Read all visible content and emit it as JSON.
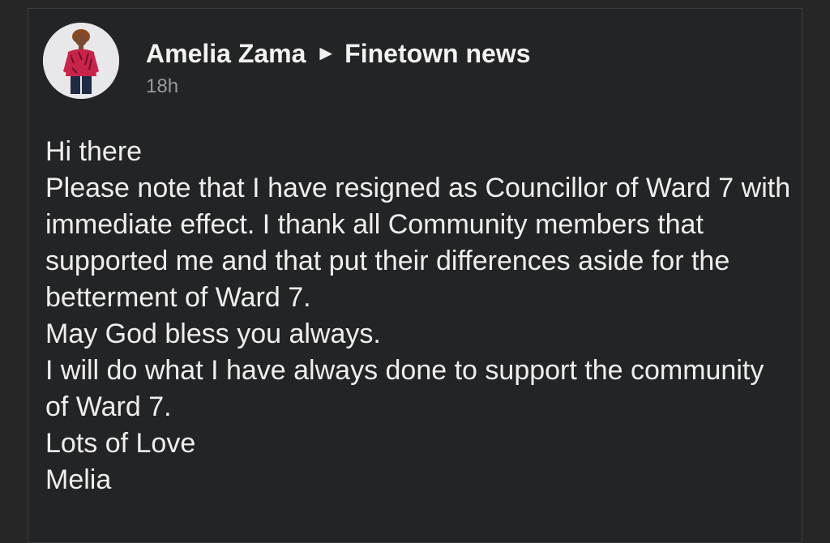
{
  "post": {
    "author": "Amelia Zama",
    "arrow": "►",
    "group": "Finetown news",
    "timestamp": "18h",
    "avatar_icon": "profile-photo-icon",
    "lines": [
      "Hi there",
      "Please note that I have resigned as Councillor of Ward 7 with immediate effect. I thank all Community members that supported me and that put their differences aside for the betterment of Ward 7.",
      "May God bless you always.",
      "I will do what I have always done to support the community of Ward 7.",
      "Lots of Love",
      "Melia"
    ]
  },
  "colors": {
    "background": "#232425",
    "text": "#eeeeee",
    "muted": "#9a9b9d"
  }
}
